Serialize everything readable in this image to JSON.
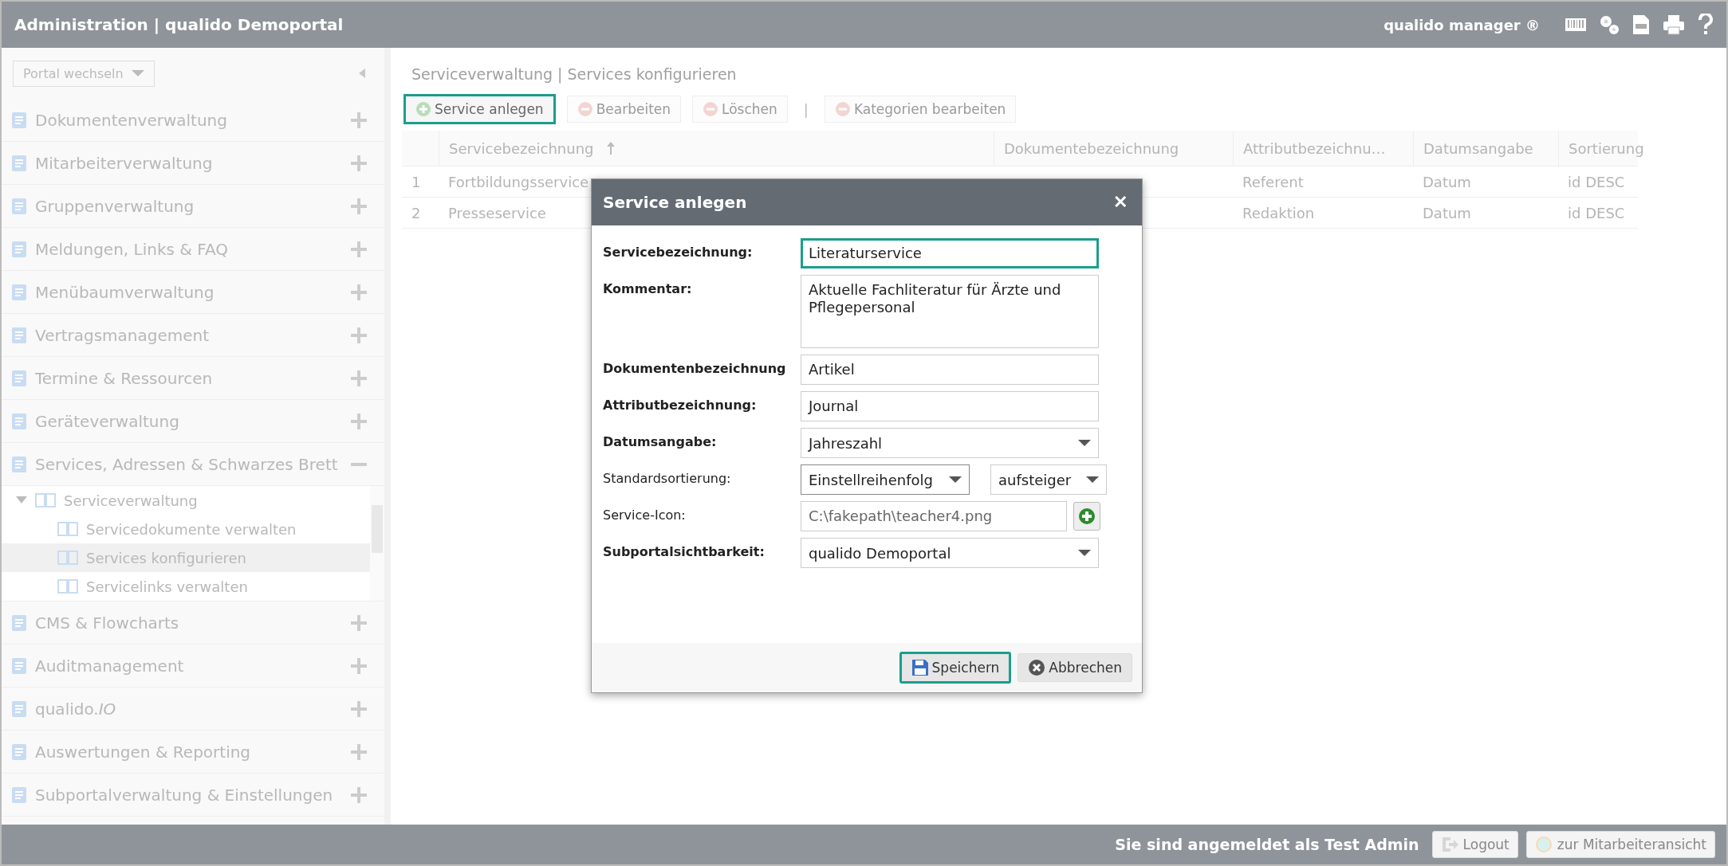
{
  "header": {
    "title": "Administration | qualido Demoportal",
    "product": "qualido manager ®"
  },
  "sidebar": {
    "portal_select": "Portal wechseln",
    "items": [
      {
        "label": "Dokumentenverwaltung",
        "expanded": false
      },
      {
        "label": "Mitarbeiterverwaltung",
        "expanded": false
      },
      {
        "label": "Gruppenverwaltung",
        "expanded": false
      },
      {
        "label": "Meldungen, Links & FAQ",
        "expanded": false
      },
      {
        "label": "Menübaumverwaltung",
        "expanded": false
      },
      {
        "label": "Vertragsmanagement",
        "expanded": false
      },
      {
        "label": "Termine & Ressourcen",
        "expanded": false
      },
      {
        "label": "Geräteverwaltung",
        "expanded": false
      },
      {
        "label": "Services, Adressen & Schwarzes Brett",
        "expanded": true,
        "children": [
          {
            "label": "Serviceverwaltung",
            "expanded": true,
            "selected": false,
            "children": [
              {
                "label": "Servicedokumente verwalten",
                "selected": false
              },
              {
                "label": "Services konfigurieren",
                "selected": true
              },
              {
                "label": "Servicelinks verwalten",
                "selected": false
              }
            ]
          }
        ]
      },
      {
        "label": "CMS & Flowcharts",
        "expanded": false
      },
      {
        "label": "Auditmanagement",
        "expanded": false
      },
      {
        "label": "qualido.*IO*",
        "expanded": false
      },
      {
        "label": "Auswertungen & Reporting",
        "expanded": false
      },
      {
        "label": "Subportalverwaltung & Einstellungen",
        "expanded": false
      }
    ]
  },
  "breadcrumb": "Serviceverwaltung | Services konfigurieren",
  "toolbar": [
    {
      "kind": "button",
      "label": "Service anlegen",
      "disabled": false,
      "focused": true
    },
    {
      "kind": "button",
      "label": "Bearbeiten",
      "disabled": true,
      "focused": false
    },
    {
      "kind": "button",
      "label": "Löschen",
      "disabled": true,
      "focused": false
    },
    {
      "kind": "separator",
      "label": "|"
    },
    {
      "kind": "button",
      "label": "Kategorien bearbeiten",
      "disabled": true,
      "focused": false
    }
  ],
  "table": {
    "columns": [
      {
        "label": "Servicebezeichnung",
        "sorted": true
      },
      {
        "label": "Dokumentebezeichnung",
        "sorted": false
      },
      {
        "label": "Attributbezeichnu…",
        "sorted": false
      },
      {
        "label": "Datumsangabe",
        "sorted": false
      },
      {
        "label": "Sortierung",
        "sorted": false
      }
    ],
    "rows": [
      {
        "number": "1",
        "name": "Fortbildungsservice",
        "attribute": "Referent",
        "date": "Datum",
        "sort": "id DESC"
      },
      {
        "number": "2",
        "name": "Presseservice",
        "attribute": "Redaktion",
        "date": "Datum",
        "sort": "id DESC"
      }
    ]
  },
  "dialog": {
    "title": "Service anlegen",
    "close": "✕",
    "fields": [
      {
        "kind": "text",
        "label": "Servicebezeichnung:",
        "required": true,
        "value": "Literaturservice",
        "focused": true
      },
      {
        "kind": "textarea",
        "label": "Kommentar:",
        "required": true,
        "value": "Aktuelle Fachliteratur für Ärzte und Pflegepersonal",
        "focused": false
      },
      {
        "kind": "text",
        "label": "Dokumentenbezeichnung",
        "required": true,
        "value": "Artikel",
        "focused": false
      },
      {
        "kind": "text",
        "label": "Attributbezeichnung:",
        "required": true,
        "value": "Journal",
        "focused": false
      },
      {
        "kind": "select",
        "label": "Datumsangabe:",
        "required": true,
        "value": "Jahreszahl",
        "focused": false
      },
      {
        "kind": "select-pair",
        "label": "Standardsortierung:",
        "required": false,
        "value": "Einstellreihenfolg",
        "value_2": "aufsteiger",
        "focused": false
      },
      {
        "kind": "file",
        "label": "Service-Icon:",
        "required": false,
        "value": "C:\\fakepath\\teacher4.png",
        "focused": false
      },
      {
        "kind": "select",
        "label": "Subportalsichtbarkeit:",
        "required": true,
        "value": "qualido Demoportal",
        "focused": false
      }
    ],
    "buttons": [
      {
        "kind": "save",
        "label": "Speichern",
        "focused": true
      },
      {
        "kind": "cancel",
        "label": "Abbrechen",
        "focused": false
      }
    ]
  },
  "footer": {
    "login_text": "Sie sind angemeldet als **Test Admin**",
    "buttons": [
      {
        "kind": "logout",
        "label": "Logout"
      },
      {
        "kind": "staff",
        "label": "zur Mitarbeiteransicht"
      }
    ]
  }
}
